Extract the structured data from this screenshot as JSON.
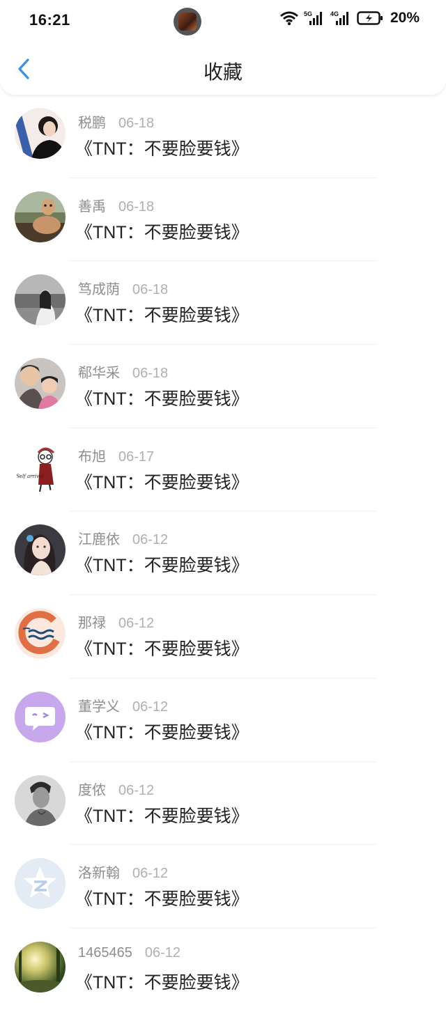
{
  "status_bar": {
    "time": "16:21",
    "battery": "20%"
  },
  "header": {
    "title": "收藏"
  },
  "items": [
    {
      "name": "税鹏",
      "date": "06-18",
      "message": "《TNT：不要脸要钱》"
    },
    {
      "name": "善禹",
      "date": "06-18",
      "message": "《TNT：不要脸要钱》"
    },
    {
      "name": "笃成荫",
      "date": "06-18",
      "message": "《TNT：不要脸要钱》"
    },
    {
      "name": "郗华采",
      "date": "06-18",
      "message": "《TNT：不要脸要钱》"
    },
    {
      "name": "布旭",
      "date": "06-17",
      "message": "《TNT：不要脸要钱》"
    },
    {
      "name": "江鹿依",
      "date": "06-12",
      "message": "《TNT：不要脸要钱》"
    },
    {
      "name": "那禄",
      "date": "06-12",
      "message": "《TNT：不要脸要钱》"
    },
    {
      "name": "董学义",
      "date": "06-12",
      "message": "《TNT：不要脸要钱》"
    },
    {
      "name": "度侬",
      "date": "06-12",
      "message": "《TNT：不要脸要钱》"
    },
    {
      "name": "洛新翰",
      "date": "06-12",
      "message": "《TNT：不要脸要钱》"
    },
    {
      "name": "1465465",
      "date": "06-12",
      "message": "《TNT：不要脸要钱》"
    }
  ],
  "colors": {
    "accent": "#3a8ee6",
    "name_gray": "#8e8e8e",
    "date_gray": "#b0b0b0"
  }
}
